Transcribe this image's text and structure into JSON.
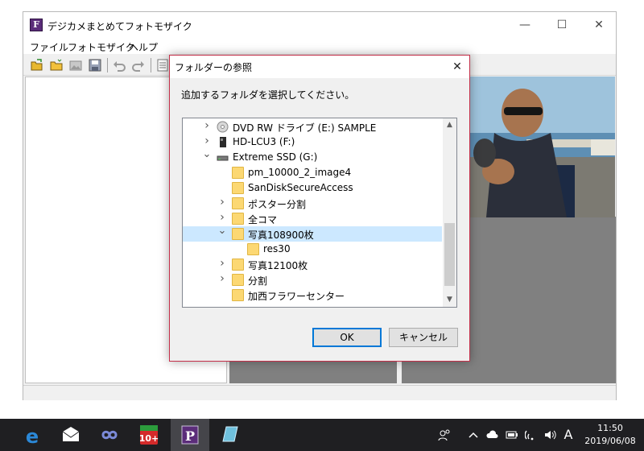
{
  "app": {
    "title": "デジカメまとめてフォトモザイク",
    "icon_letter": "F",
    "menu": [
      "ファイル",
      "フォトモザイク",
      "ヘルプ"
    ],
    "window_buttons": [
      "—",
      "☐",
      "✕"
    ]
  },
  "dialog": {
    "title": "フォルダーの参照",
    "instruction": "追加するフォルダを選択してください。",
    "close_glyph": "✕",
    "tree": [
      {
        "label": "DVD RW ドライブ (E:) SAMPLE",
        "icon": "dvd-drive-icon",
        "expander": "collapsed"
      },
      {
        "label": "HD-LCU3 (F:)",
        "icon": "usb-drive-icon",
        "expander": "collapsed"
      },
      {
        "label": "Extreme SSD (G:)",
        "icon": "ssd-drive-icon",
        "expander": "expanded"
      },
      {
        "label": "pm_10000_2_image4",
        "icon": "folder-icon",
        "expander": "none"
      },
      {
        "label": "SanDiskSecureAccess",
        "icon": "folder-icon",
        "expander": "none"
      },
      {
        "label": "ポスター分割",
        "icon": "folder-icon",
        "expander": "collapsed"
      },
      {
        "label": "全コマ",
        "icon": "folder-icon",
        "expander": "collapsed"
      },
      {
        "label": "写真108900枚",
        "icon": "folder-icon",
        "expander": "expanded",
        "selected": true
      },
      {
        "label": "res30",
        "icon": "folder-icon",
        "expander": "none"
      },
      {
        "label": "写真12100枚",
        "icon": "folder-icon",
        "expander": "collapsed"
      },
      {
        "label": "分割",
        "icon": "folder-icon",
        "expander": "collapsed"
      },
      {
        "label": "加西フラワーセンター",
        "icon": "folder-icon",
        "expander": "none"
      }
    ],
    "ok_label": "OK",
    "cancel_label": "キャンセル"
  },
  "taskbar": {
    "apps": [
      "edge-icon",
      "mail-icon",
      "infinity-app-icon",
      "calendar-10plus-icon",
      "photomosaic-app-icon",
      "note-app-icon"
    ],
    "badge": "10+",
    "app_letter": "P",
    "ime_indicator": "A",
    "time": "11:50",
    "date": "2019/06/08"
  },
  "colors": {
    "dialog_border": "#c4304a",
    "selection": "#cce8ff",
    "accent": "#0078d7",
    "folder": "#fcd873",
    "taskbar": "#1f1f22"
  }
}
